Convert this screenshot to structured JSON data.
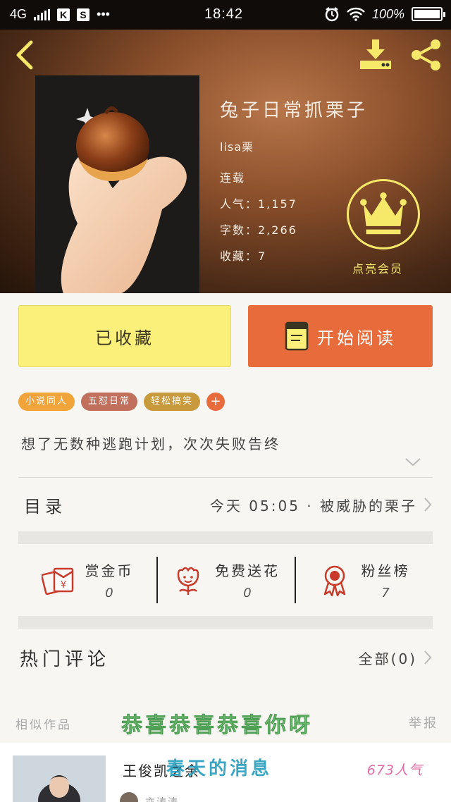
{
  "status_bar": {
    "network": "4G",
    "app_icon_1": "K",
    "app_icon_2": "S",
    "more": "•••",
    "time": "18:42",
    "battery": "100%",
    "battery_level": 1.0
  },
  "header": {
    "back_icon": "chevron-left-icon",
    "download_icon": "download-icon",
    "share_icon": "share-icon"
  },
  "book": {
    "title": "兔子日常抓栗子",
    "author": "lisa栗",
    "status": "连载",
    "popularity": "人气：1,157",
    "word_count": "字数：2,266",
    "favorites": "收藏：7"
  },
  "vip": {
    "icon": "crown-icon",
    "label": "点亮会员",
    "color": "#f6e96a"
  },
  "actions": {
    "collected_label": "已收藏",
    "read_label": "开始阅读",
    "read_color": "#e86b3c",
    "collected_color": "#fbf07a"
  },
  "tags": [
    {
      "label": "小说同人",
      "color": "#f1a43a"
    },
    {
      "label": "五怼日常",
      "color": "#c0705c"
    },
    {
      "label": "轻松搞笑",
      "color": "#c99a3c"
    }
  ],
  "tag_add": "+",
  "description": "想了无数种逃跑计划，次次失败告终",
  "catalog": {
    "label": "目录",
    "latest": "今天 05:05 · 被威胁的栗子"
  },
  "stats": [
    {
      "name": "赏金币",
      "value": "0",
      "icon": "red-envelope-icon"
    },
    {
      "name": "免费送花",
      "value": "0",
      "icon": "flower-icon"
    },
    {
      "name": "粉丝榜",
      "value": "7",
      "icon": "medal-icon"
    }
  ],
  "comments": {
    "label": "热门评论",
    "all": "全部(0)"
  },
  "similar": {
    "label": "相似作品",
    "report": "举报",
    "overlay": "恭喜恭喜恭喜你呀"
  },
  "similar_item": {
    "title": "王俊凯之余",
    "overlay": "春天的消息",
    "popularity": "673人气",
    "author": "亦涛涛"
  }
}
